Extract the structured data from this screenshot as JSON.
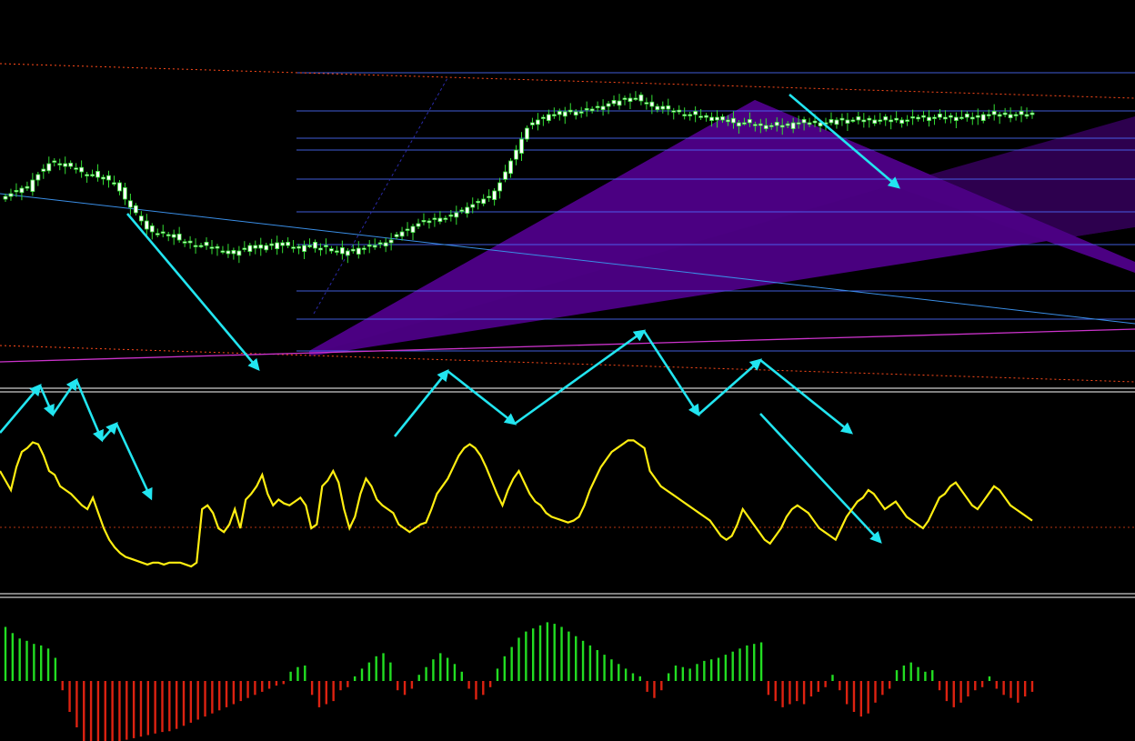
{
  "colors": {
    "background": "#000000",
    "bull_candle": "#ffffff",
    "bear_candle": "#ffffff",
    "candle_wick": "#33dd33",
    "channel_fill": "#4b0082",
    "fib_lines": "#4d6bff",
    "trendline": "#3a8ee6",
    "magenta_line": "#cc33cc",
    "dotted_level": "#ff4a1a",
    "arrows": "#22e5f0",
    "oscillator": "#ffee11",
    "hist_pos": "#22dd22",
    "hist_neg": "#dd2211",
    "separator": "#ffffff"
  },
  "chart_data": [
    {
      "type": "candlestick",
      "panel": "price",
      "x_range": [
        0,
        190
      ],
      "y_range": [
        0,
        100
      ],
      "closes": [
        58,
        59,
        60,
        61,
        61,
        64,
        66,
        68,
        70,
        71,
        70,
        69,
        69,
        68,
        67,
        66,
        66,
        65,
        65,
        64,
        63,
        60,
        57,
        54,
        52,
        49,
        46,
        45,
        44,
        45,
        44,
        43,
        42,
        41,
        41,
        40,
        40,
        40,
        39,
        39,
        38,
        37,
        37,
        38,
        39,
        40,
        39,
        39,
        40,
        40,
        41,
        40,
        40,
        39,
        39,
        40,
        40,
        39,
        39,
        40,
        38,
        38,
        37,
        38,
        38,
        39,
        39,
        40,
        40,
        41,
        41,
        42,
        44,
        45,
        46,
        47,
        48,
        49,
        49,
        50,
        50,
        50,
        51,
        52,
        53,
        54,
        55,
        56,
        57,
        58,
        60,
        63,
        67,
        71,
        75,
        79,
        83,
        85,
        86,
        87,
        88,
        88,
        88,
        89,
        89,
        89,
        89,
        90,
        90,
        91,
        91,
        92,
        92,
        93,
        94,
        94,
        94,
        93,
        92,
        91,
        91,
        90,
        90,
        89,
        89,
        88,
        88,
        88,
        87,
        87,
        87,
        86,
        86,
        86,
        85,
        85,
        85,
        85,
        84,
        84,
        84,
        84,
        84,
        84,
        84,
        85,
        85,
        85,
        85,
        85,
        85,
        85,
        85,
        86,
        86,
        86,
        86,
        86,
        86,
        86,
        86,
        86,
        86,
        86,
        86,
        86,
        86,
        87,
        87,
        87,
        87,
        87,
        87,
        87,
        87,
        87,
        87,
        87,
        87,
        87,
        88,
        88,
        88,
        88,
        88,
        88,
        88,
        88,
        88,
        88
      ]
    },
    {
      "type": "line",
      "panel": "oscillator",
      "y_range": [
        0,
        100
      ],
      "values": [
        60,
        55,
        50,
        62,
        70,
        72,
        75,
        74,
        68,
        60,
        58,
        52,
        50,
        48,
        45,
        42,
        40,
        46,
        38,
        30,
        24,
        20,
        17,
        15,
        14,
        13,
        12,
        11,
        12,
        12,
        11,
        12,
        12,
        12,
        11,
        10,
        12,
        40,
        42,
        38,
        30,
        28,
        32,
        40,
        30,
        45,
        48,
        52,
        58,
        48,
        42,
        45,
        43,
        42,
        44,
        46,
        42,
        30,
        32,
        52,
        55,
        60,
        54,
        40,
        30,
        36,
        48,
        56,
        52,
        45,
        42,
        40,
        38,
        32,
        30,
        28,
        30,
        32,
        33,
        40,
        48,
        52,
        56,
        62,
        68,
        72,
        74,
        72,
        68,
        62,
        55,
        48,
        42,
        50,
        56,
        60,
        54,
        48,
        44,
        42,
        38,
        36,
        35,
        34,
        33,
        34,
        36,
        42,
        50,
        56,
        62,
        66,
        70,
        72,
        74,
        76,
        76,
        74,
        72,
        60,
        56,
        52,
        50,
        48,
        46,
        44,
        42,
        40,
        38,
        36,
        34,
        30,
        26,
        24,
        26,
        32,
        40,
        36,
        32,
        28,
        24,
        22,
        26,
        30,
        36,
        40,
        42,
        40,
        38,
        34,
        30,
        28,
        26,
        24,
        30,
        36,
        40,
        44,
        46,
        50,
        48,
        44,
        40,
        42,
        44,
        40,
        36,
        34,
        32,
        30,
        34,
        40,
        46,
        48,
        52,
        54,
        50,
        46,
        42,
        40,
        44,
        48,
        52,
        50,
        46,
        42,
        40,
        38,
        36,
        34
      ]
    },
    {
      "type": "bar",
      "panel": "histogram",
      "y_range": [
        -100,
        100
      ],
      "values": [
        70,
        62,
        55,
        52,
        48,
        46,
        42,
        30,
        -12,
        -40,
        -60,
        -80,
        -90,
        -88,
        -86,
        -84,
        -80,
        -76,
        -74,
        -72,
        -70,
        -68,
        -66,
        -65,
        -62,
        -58,
        -54,
        -50,
        -46,
        -42,
        -38,
        -34,
        -30,
        -26,
        -22,
        -18,
        -14,
        -10,
        -6,
        -4,
        12,
        18,
        20,
        -18,
        -34,
        -30,
        -26,
        -12,
        -8,
        6,
        16,
        24,
        32,
        36,
        24,
        -12,
        -18,
        -10,
        8,
        18,
        28,
        36,
        30,
        22,
        12,
        -10,
        -24,
        -18,
        -8,
        16,
        32,
        44,
        56,
        64,
        68,
        72,
        76,
        74,
        70,
        64,
        58,
        52,
        46,
        40,
        34,
        28,
        22,
        16,
        10,
        6,
        -14,
        -22,
        -12,
        10,
        20,
        18,
        16,
        22,
        26,
        28,
        30,
        34,
        38,
        42,
        46,
        48,
        50,
        -18,
        -26,
        -34,
        -30,
        -26,
        -30,
        -20,
        -14,
        -8,
        8,
        -12,
        -30,
        -40,
        -46,
        -42,
        -28,
        -18,
        -10,
        14,
        20,
        24,
        18,
        12,
        14,
        -12,
        -26,
        -34,
        -28,
        -20,
        -12,
        -8,
        6,
        -10,
        -18,
        -22,
        -28,
        -20,
        -14
      ]
    }
  ]
}
